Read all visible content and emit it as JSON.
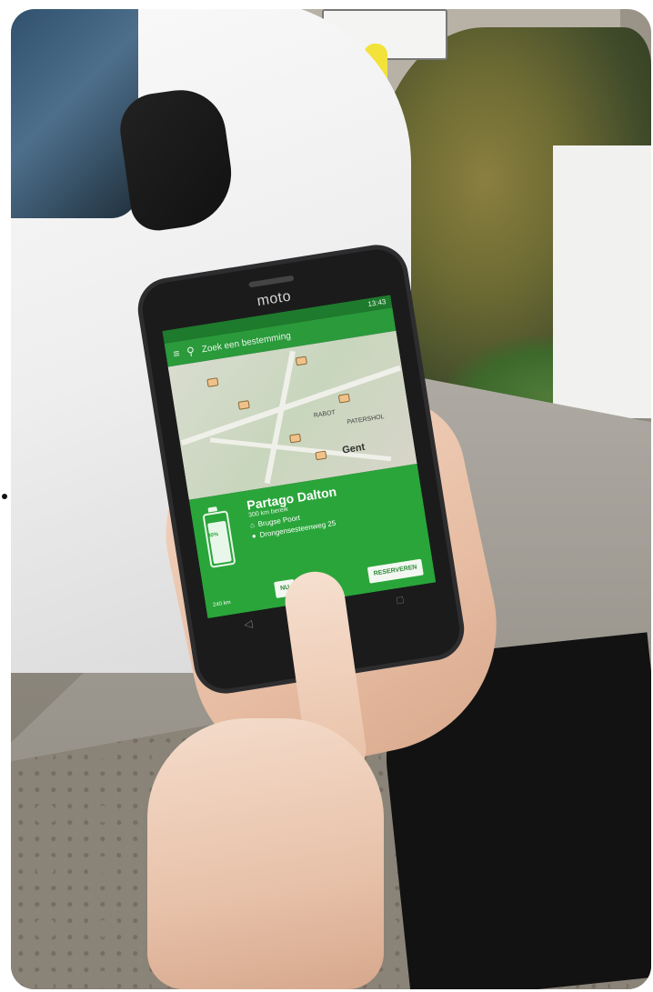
{
  "phone": {
    "brand": "moto",
    "status_time": "13:43"
  },
  "app": {
    "search_placeholder": "Zoek een bestemming",
    "accent_color": "#2aa53a",
    "map": {
      "city_label": "Gent",
      "area_labels": [
        "RABOT",
        "PATERSHOL"
      ]
    },
    "card": {
      "car_name": "Partago Dalton",
      "subtitle": "300 km bereik",
      "location_name": "Brugse Poort",
      "address": "Drongensesteenweg 25",
      "battery_percent_label": "80%",
      "battery_level": 0.8,
      "range_label": "240 km",
      "now_button": "NU",
      "reserve_button": "RESERVEREN"
    }
  }
}
